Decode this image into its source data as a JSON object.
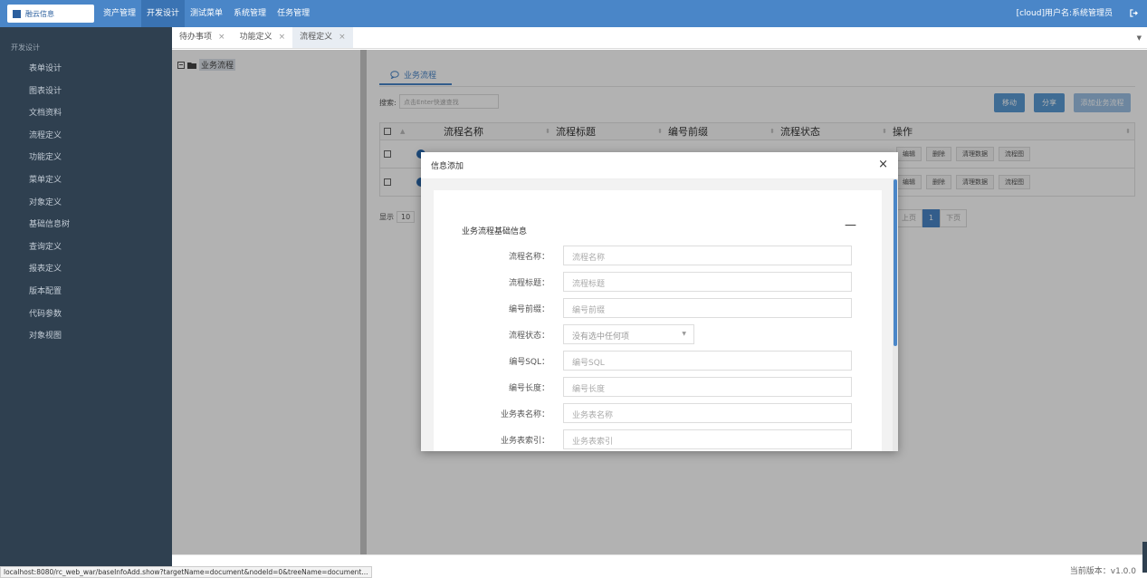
{
  "app": {
    "logo_text": "融云信息",
    "top_nav": [
      "资产管理",
      "开发设计",
      "测试菜单",
      "系统管理",
      "任务管理"
    ],
    "active_top_nav": "开发设计",
    "user": "[cloud]用户名:系统管理员"
  },
  "sidebar": {
    "heading": "开发设计",
    "items": [
      "表单设计",
      "图表设计",
      "文档资料",
      "流程定义",
      "功能定义",
      "菜单定义",
      "对象定义",
      "基础信息树",
      "查询定义",
      "报表定义",
      "版本配置",
      "代码参数",
      "对象视图"
    ]
  },
  "tabs": [
    {
      "label": "待办事项",
      "close": "×"
    },
    {
      "label": "功能定义",
      "close": "×"
    },
    {
      "label": "流程定义",
      "close": "×"
    }
  ],
  "tree": {
    "root_label": "业务流程"
  },
  "main": {
    "tab_label": "业务流程",
    "search_label": "搜索:",
    "search_placeholder": "点击Enter快速查找",
    "buttons": [
      "移动",
      "分享",
      "添加业务流程"
    ],
    "columns": [
      "流程名称",
      "流程标题",
      "编号前缀",
      "流程状态",
      "操作"
    ],
    "rows": [
      {
        "name": "",
        "title": "",
        "prefix": "",
        "status": ""
      },
      {
        "name": "",
        "title": "",
        "prefix": "",
        "status": ""
      }
    ],
    "row_actions": [
      "编辑",
      "删除",
      "清理数据",
      "流程图"
    ],
    "pager": {
      "show_label": "显示",
      "page_size": "10",
      "prev": "上页",
      "current": "1",
      "next": "下页"
    }
  },
  "footer": {
    "version": "当前版本：v1.0.0",
    "status_url": "localhost:8080/rc_web_war/baseInfoAdd.show?targetName=document&nodeId=0&treeName=document..."
  },
  "modal": {
    "title": "信息添加",
    "close": "×",
    "section_title": "业务流程基础信息",
    "collapse_symbol": "—",
    "fields": [
      {
        "label": "流程名称：",
        "placeholder": "流程名称",
        "type": "text"
      },
      {
        "label": "流程标题：",
        "placeholder": "流程标题",
        "type": "text"
      },
      {
        "label": "编号前缀：",
        "placeholder": "编号前缀",
        "type": "text"
      },
      {
        "label": "流程状态：",
        "placeholder": "没有选中任何项",
        "type": "select"
      },
      {
        "label": "编号SQL：",
        "placeholder": "编号SQL",
        "type": "text"
      },
      {
        "label": "编号长度：",
        "placeholder": "编号长度",
        "type": "text"
      },
      {
        "label": "业务表名称：",
        "placeholder": "业务表名称",
        "type": "text"
      },
      {
        "label": "业务表索引：",
        "placeholder": "业务表索引",
        "type": "text"
      }
    ]
  },
  "colors": {
    "topbar": "#4a86c8",
    "sidebar": "#2f4050",
    "accent": "#4a86c8",
    "button": "#5b9bd5"
  }
}
